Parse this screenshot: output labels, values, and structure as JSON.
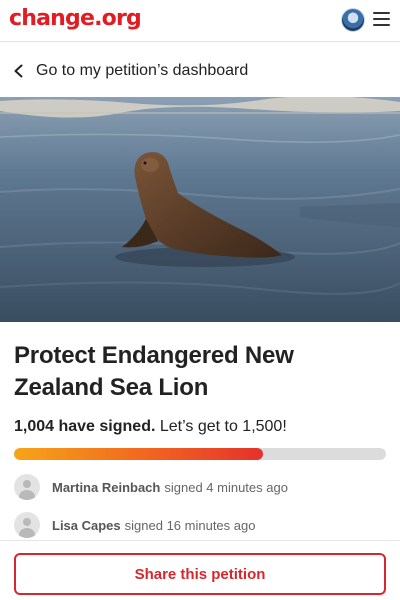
{
  "header": {
    "logo_text": "change.org",
    "brand_color": "#e31b23",
    "icons": {
      "profile": "user-avatar-icon",
      "menu": "hamburger-menu-icon"
    }
  },
  "nav": {
    "back_label": "Go to my petition’s dashboard",
    "back_icon": "chevron-left-icon"
  },
  "petition": {
    "title": "Protect Endangered New Zealand Sea Lion",
    "signed_count_text": "1,004 have signed.",
    "goal_text": "Let’s get to 1,500!",
    "progress_fraction": 0.669,
    "progress_colors": [
      "#f7a418",
      "#e5322b"
    ]
  },
  "recent_signers": [
    {
      "name": "Martina Reinbach",
      "action": "signed 4 minutes ago"
    },
    {
      "name": "Lisa Capes",
      "action": "signed 16 minutes ago"
    }
  ],
  "footer": {
    "share_label": "Share this petition",
    "share_color": "#d8262d"
  }
}
